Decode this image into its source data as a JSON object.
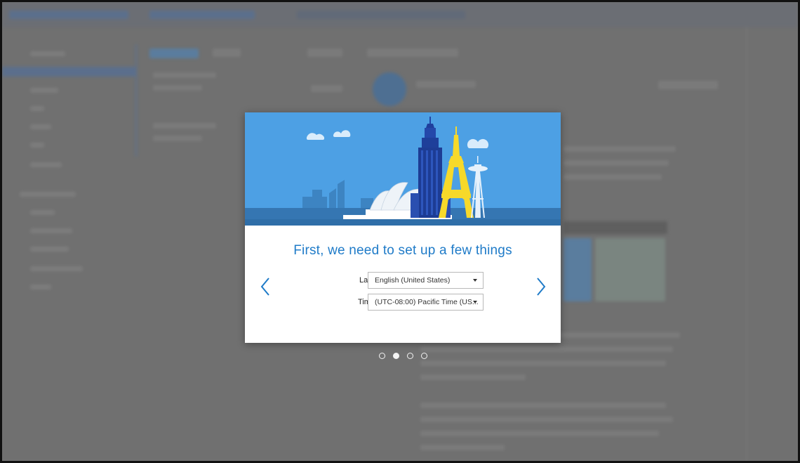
{
  "modal": {
    "title": "First, we need to set up a few things",
    "language": {
      "label": "Language",
      "value": "English (United States)"
    },
    "timezone": {
      "label": "Time zone",
      "value": "(UTC-08:00) Pacific Time (US..."
    },
    "prev_icon": "chevron-left-icon",
    "next_icon": "chevron-right-icon",
    "accent_color": "#1f7bc8",
    "hero_color": "#4da0e4"
  },
  "pager": {
    "total_pages": 4,
    "current_page": 2
  }
}
